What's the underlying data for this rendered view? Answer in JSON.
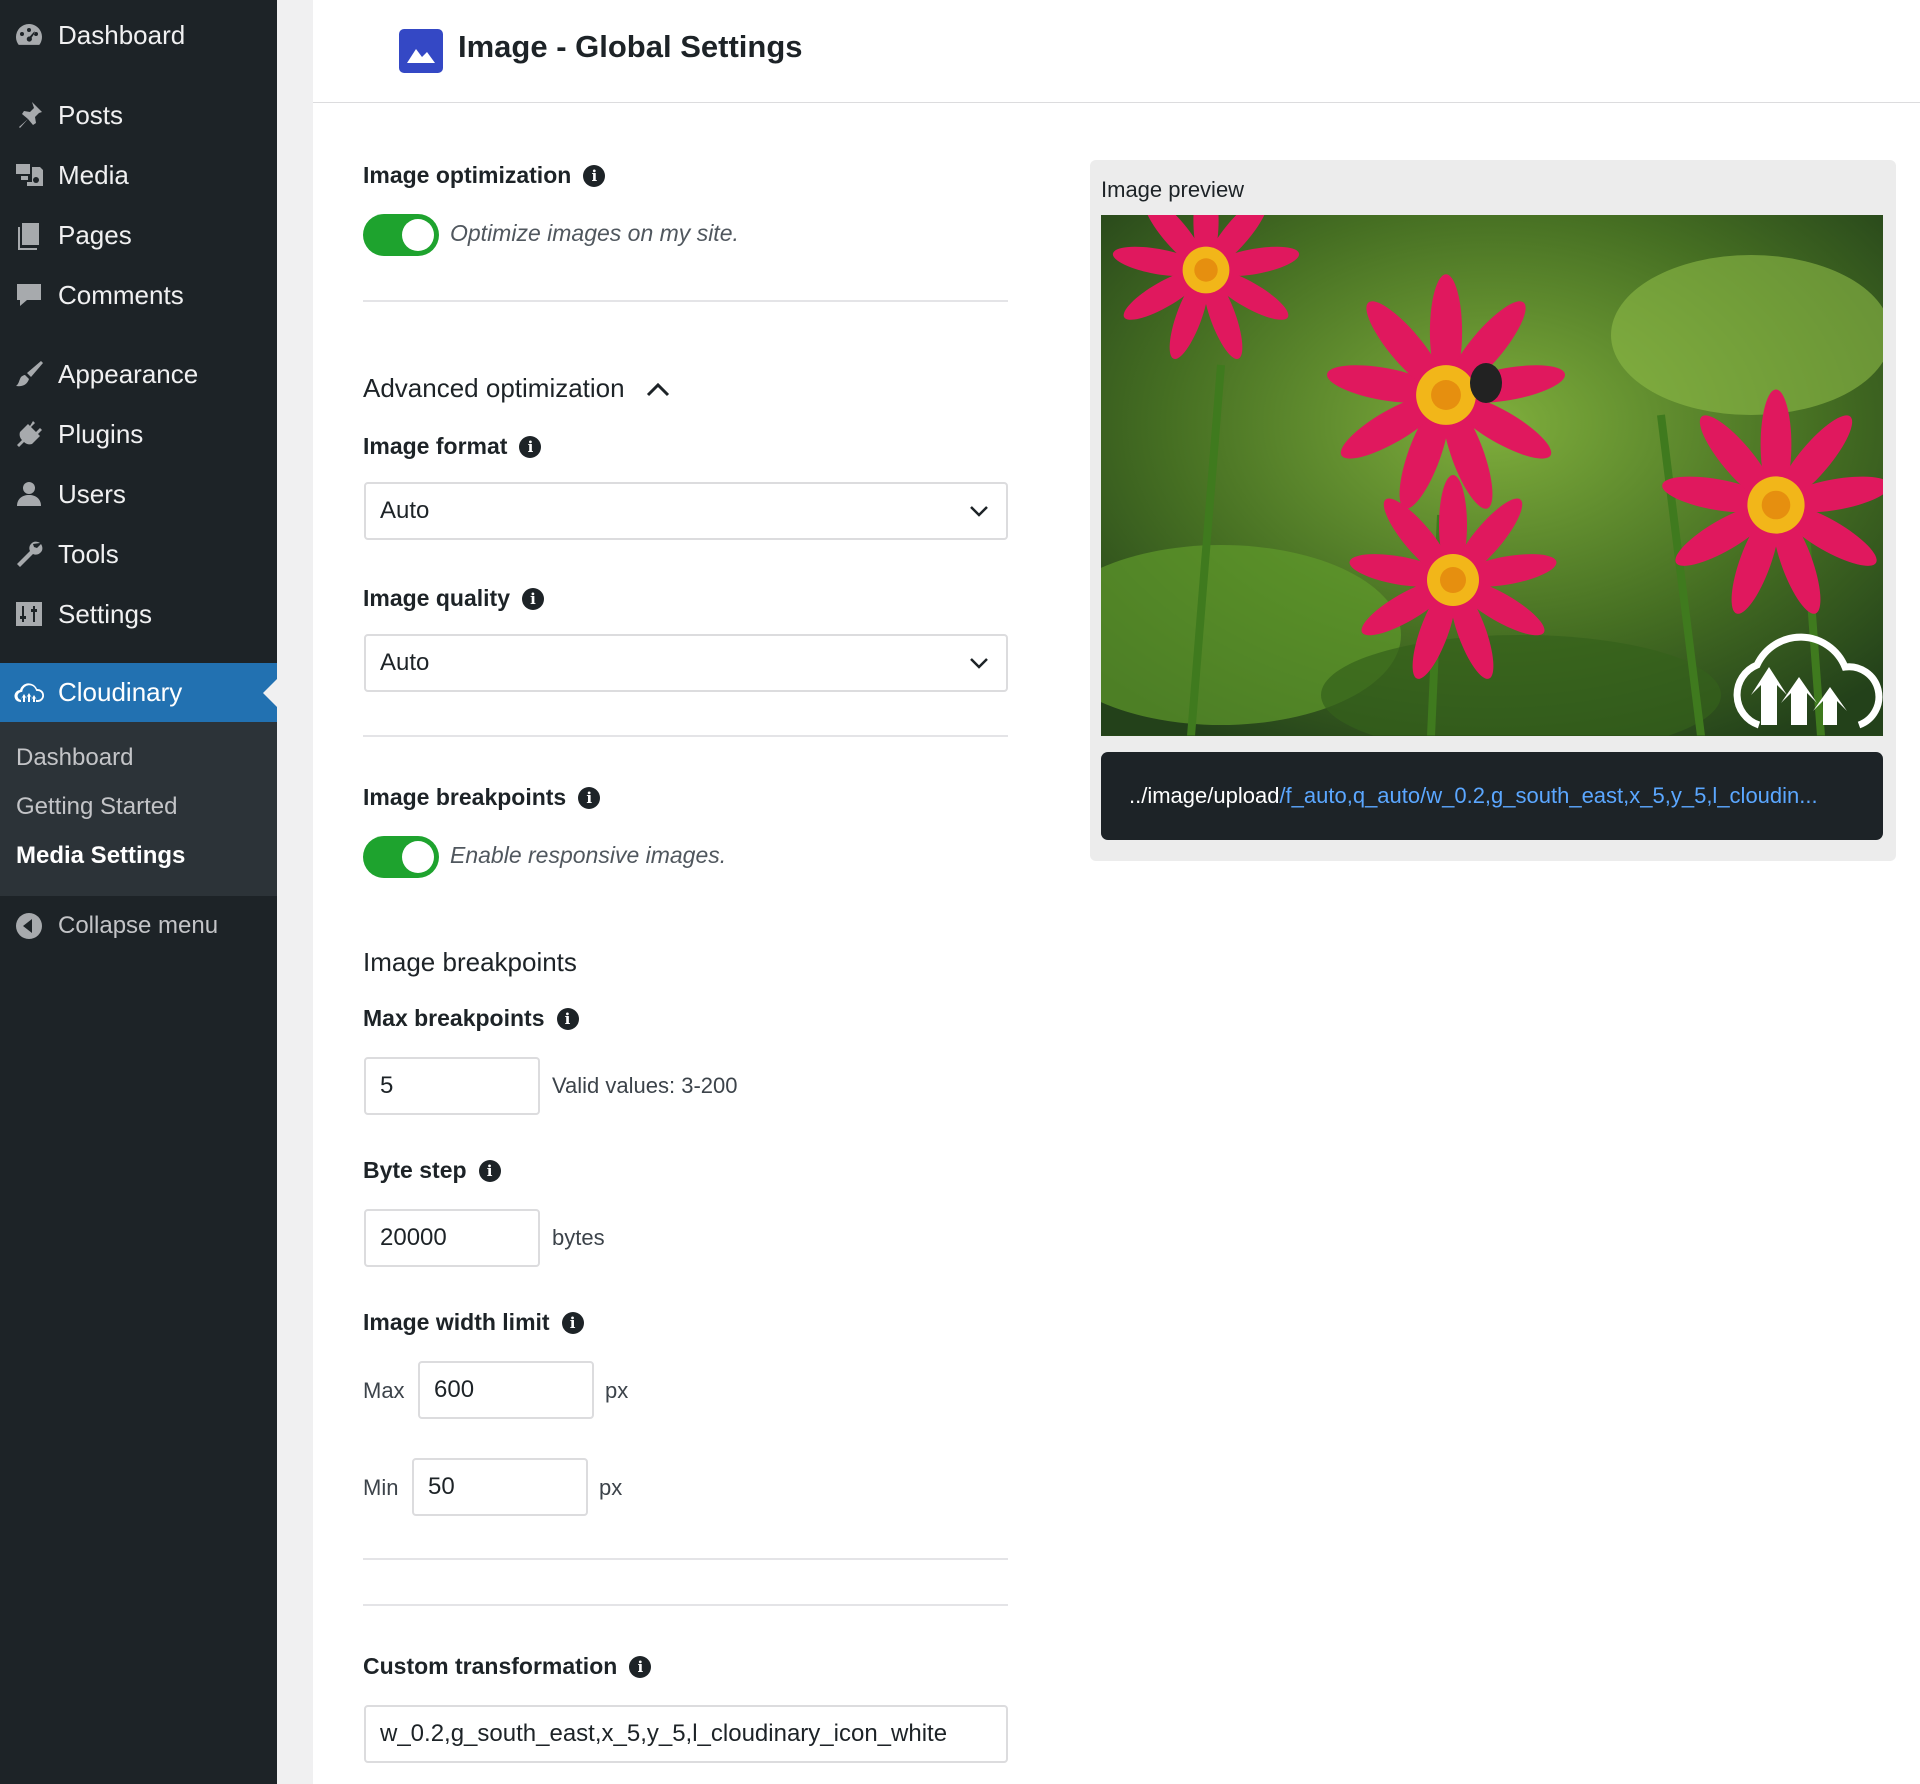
{
  "sidebar": {
    "items": [
      {
        "label": "Dashboard",
        "icon": "dashboard-icon"
      },
      {
        "label": "Posts",
        "icon": "pin-icon"
      },
      {
        "label": "Media",
        "icon": "media-icon"
      },
      {
        "label": "Pages",
        "icon": "pages-icon"
      },
      {
        "label": "Comments",
        "icon": "comment-icon"
      },
      {
        "label": "Appearance",
        "icon": "brush-icon"
      },
      {
        "label": "Plugins",
        "icon": "plug-icon"
      },
      {
        "label": "Users",
        "icon": "user-icon"
      },
      {
        "label": "Tools",
        "icon": "wrench-icon"
      },
      {
        "label": "Settings",
        "icon": "sliders-icon"
      },
      {
        "label": "Cloudinary",
        "icon": "cloud-icon"
      }
    ],
    "submenu": [
      "Dashboard",
      "Getting Started",
      "Media Settings"
    ],
    "collapse_label": "Collapse menu",
    "active_color": "#2271b1"
  },
  "header": {
    "title": "Image - Global Settings",
    "icon": "image-icon",
    "icon_color": "#3448c5"
  },
  "settings": {
    "image_optimization": {
      "label": "Image optimization",
      "toggle_on": true,
      "description": "Optimize images on my site."
    },
    "advanced": {
      "label": "Advanced optimization",
      "expanded": true
    },
    "image_format": {
      "label": "Image format",
      "value": "Auto"
    },
    "image_quality": {
      "label": "Image quality",
      "value": "Auto"
    },
    "image_breakpoints": {
      "label": "Image breakpoints",
      "toggle_on": true,
      "description": "Enable responsive images."
    },
    "breakpoints_section": {
      "title": "Image breakpoints"
    },
    "max_breakpoints": {
      "label": "Max breakpoints",
      "value": "5",
      "hint": "Valid values: 3-200"
    },
    "byte_step": {
      "label": "Byte step",
      "value": "20000",
      "unit": "bytes"
    },
    "width_limit": {
      "label": "Image width limit",
      "max_label": "Max",
      "max_value": "600",
      "min_label": "Min",
      "min_value": "50",
      "unit": "px"
    },
    "custom_transformation": {
      "label": "Custom transformation",
      "value": "w_0.2,g_south_east,x_5,y_5,l_cloudinary_icon_white"
    }
  },
  "preview": {
    "title": "Image preview",
    "url_base": "../image/upload",
    "url_transform": "/f_auto,q_auto/w_0.2,g_south_east,x_5,y_5,l_cloudin...",
    "toggle_color": "#1ea32e"
  }
}
